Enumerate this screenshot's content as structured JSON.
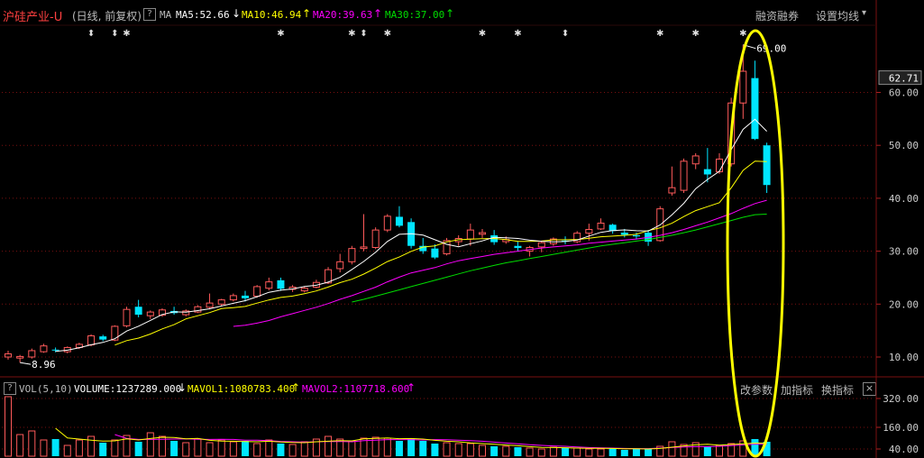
{
  "header": {
    "stock_name": "沪硅产业-U",
    "period": "(日线, 前复权)",
    "help_icon": "?",
    "ma_label": "MA",
    "ma5": "MA5:52.66",
    "ma10": "MA10:46.94",
    "ma20": "MA20:39.63",
    "ma30": "MA30:37.00",
    "menu_margin": "融资融券",
    "menu_settings": "设置均线",
    "menu_caret": "▾"
  },
  "volume_header": {
    "help_icon": "?",
    "label": "VOL(5,10)",
    "volume": "VOLUME:1237289.000",
    "mavol1": "MAVOL1:1080783.400",
    "mavol2": "MAVOL2:1107718.600",
    "btn_params": "改参数",
    "btn_add": "加指标",
    "btn_switch": "换指标",
    "btn_close": "×"
  },
  "colors": {
    "up": "#ff5a5a",
    "down": "#00e5ff",
    "ma5": "#ffffff",
    "ma10": "#ffff00",
    "ma20": "#ff00ff",
    "ma30": "#00dd00",
    "grid": "#7a1010",
    "highlight": "#ffff00"
  },
  "chart_data": [
    {
      "type": "candlestick",
      "y_ticks": [
        "10.00",
        "20.00",
        "30.00",
        "40.00",
        "50.00",
        "60.00"
      ],
      "ylim": [
        5,
        72
      ],
      "current_price": "62.71",
      "high_label": "69.00",
      "low_label": "8.96",
      "ohlc": [
        [
          10.0,
          11.2,
          9.5,
          10.6
        ],
        [
          9.8,
          10.4,
          8.96,
          10.1
        ],
        [
          10.0,
          11.6,
          9.7,
          11.2
        ],
        [
          11.0,
          12.5,
          10.8,
          12.1
        ],
        [
          11.4,
          11.8,
          10.9,
          11.3
        ],
        [
          11.0,
          12.0,
          10.7,
          11.8
        ],
        [
          11.8,
          12.7,
          11.5,
          12.4
        ],
        [
          12.3,
          14.3,
          12.0,
          14.0
        ],
        [
          13.9,
          14.2,
          13.0,
          13.3
        ],
        [
          13.2,
          16.0,
          13.0,
          15.8
        ],
        [
          15.9,
          19.5,
          15.6,
          19.0
        ],
        [
          19.5,
          20.8,
          17.5,
          18.0
        ],
        [
          17.8,
          18.8,
          17.2,
          18.5
        ],
        [
          17.9,
          19.2,
          17.6,
          18.9
        ],
        [
          18.7,
          19.5,
          18.0,
          18.3
        ],
        [
          18.0,
          19.0,
          17.7,
          18.7
        ],
        [
          18.5,
          19.8,
          18.3,
          19.5
        ],
        [
          19.4,
          22.0,
          19.0,
          20.2
        ],
        [
          20.0,
          21.0,
          19.6,
          20.8
        ],
        [
          20.8,
          22.0,
          20.5,
          21.6
        ],
        [
          21.6,
          22.5,
          20.5,
          21.1
        ],
        [
          21.5,
          23.6,
          21.2,
          23.3
        ],
        [
          23.0,
          25.0,
          22.6,
          24.2
        ],
        [
          24.5,
          25.0,
          22.5,
          22.9
        ],
        [
          22.8,
          23.6,
          22.3,
          23.2
        ],
        [
          22.5,
          23.4,
          22.2,
          23.0
        ],
        [
          23.2,
          24.6,
          23.0,
          24.1
        ],
        [
          24.0,
          27.0,
          23.8,
          26.5
        ],
        [
          26.7,
          29.5,
          26.0,
          28.0
        ],
        [
          28.0,
          31.0,
          27.5,
          30.5
        ],
        [
          30.5,
          37.0,
          30.0,
          30.8
        ],
        [
          30.7,
          34.5,
          30.4,
          34.0
        ],
        [
          34.0,
          37.0,
          33.6,
          36.6
        ],
        [
          36.5,
          38.5,
          34.5,
          34.8
        ],
        [
          35.5,
          36.2,
          30.5,
          31.0
        ],
        [
          31.0,
          32.5,
          29.5,
          30.0
        ],
        [
          30.5,
          31.3,
          28.5,
          28.8
        ],
        [
          29.5,
          32.5,
          29.2,
          32.0
        ],
        [
          31.8,
          33.0,
          31.0,
          32.4
        ],
        [
          32.3,
          35.2,
          31.0,
          34.0
        ],
        [
          33.2,
          34.2,
          32.5,
          33.5
        ],
        [
          33.0,
          34.0,
          31.2,
          31.7
        ],
        [
          31.8,
          32.8,
          31.4,
          32.2
        ],
        [
          31.0,
          31.8,
          30.0,
          30.6
        ],
        [
          30.0,
          31.0,
          29.0,
          30.7
        ],
        [
          30.8,
          32.0,
          29.8,
          31.6
        ],
        [
          31.4,
          32.6,
          31.0,
          32.3
        ],
        [
          32.0,
          32.8,
          31.3,
          31.9
        ],
        [
          31.8,
          33.8,
          31.5,
          33.4
        ],
        [
          33.4,
          35.2,
          32.0,
          34.1
        ],
        [
          34.2,
          36.2,
          34.0,
          35.3
        ],
        [
          35.0,
          35.2,
          33.3,
          33.8
        ],
        [
          33.5,
          34.2,
          32.6,
          33.1
        ],
        [
          33.0,
          33.5,
          32.2,
          32.8
        ],
        [
          33.5,
          34.0,
          31.0,
          31.8
        ],
        [
          32.0,
          38.5,
          31.8,
          38.0
        ],
        [
          41.0,
          46.0,
          40.5,
          42.0
        ],
        [
          41.5,
          47.5,
          41.0,
          47.0
        ],
        [
          46.5,
          48.5,
          45.5,
          48.0
        ],
        [
          45.5,
          49.5,
          43.0,
          44.5
        ],
        [
          45.0,
          48.5,
          44.6,
          47.4
        ],
        [
          46.5,
          59.0,
          46.0,
          58.0
        ],
        [
          58.0,
          69.0,
          55.0,
          64.0
        ],
        [
          62.71,
          66.0,
          51.0,
          51.2
        ],
        [
          50.0,
          50.5,
          41.0,
          42.5
        ]
      ],
      "ma5": [
        null,
        null,
        null,
        null,
        11.06,
        11.3,
        11.76,
        12.32,
        12.76,
        13.46,
        14.9,
        15.82,
        16.92,
        18.04,
        18.54,
        18.48,
        18.78,
        19.12,
        19.64,
        20.16,
        20.64,
        21.4,
        22.24,
        22.62,
        22.86,
        23.32,
        23.56,
        24.16,
        25.06,
        26.54,
        28.06,
        29.8,
        31.84,
        33.18,
        33.3,
        33.04,
        32.16,
        31.3,
        30.84,
        31.42,
        31.94,
        32.62,
        32.52,
        32.4,
        32.08,
        31.88,
        31.76,
        31.82,
        32.12,
        32.86,
        33.56,
        33.9,
        34.02,
        33.86,
        33.8,
        34.96,
        36.88,
        39.04,
        41.8,
        43.56,
        45.1,
        49.18,
        53.02,
        54.92,
        52.66
      ],
      "ma10": [
        null,
        null,
        null,
        null,
        null,
        null,
        null,
        null,
        null,
        12.26,
        13.1,
        13.58,
        14.34,
        15.32,
        16.12,
        17.2,
        17.8,
        18.4,
        19.14,
        19.34,
        19.56,
        20.18,
        20.78,
        21.26,
        21.52,
        21.98,
        22.48,
        23.22,
        24.06,
        24.7,
        25.68,
        26.82,
        28.04,
        28.9,
        29.96,
        30.78,
        31.0,
        31.76,
        32.16,
        32.28,
        32.36,
        32.4,
        32.18,
        31.84,
        31.84,
        31.9,
        32.14,
        32.16,
        32.2,
        32.46,
        32.72,
        32.84,
        33.0,
        33.18,
        33.88,
        34.42,
        35.28,
        36.54,
        37.66,
        38.42,
        39.16,
        41.96,
        45.26,
        47.02,
        46.94
      ],
      "ma20": [
        null,
        null,
        null,
        null,
        null,
        null,
        null,
        null,
        null,
        null,
        null,
        null,
        null,
        null,
        null,
        null,
        null,
        null,
        null,
        15.8,
        16.0,
        16.4,
        16.9,
        17.6,
        18.2,
        18.8,
        19.4,
        20.1,
        20.9,
        21.6,
        22.4,
        23.2,
        24.2,
        25.1,
        25.9,
        26.4,
        26.9,
        27.6,
        28.2,
        28.6,
        29.0,
        29.4,
        29.7,
        30.0,
        30.3,
        30.6,
        30.8,
        31.0,
        31.2,
        31.5,
        31.7,
        31.9,
        32.1,
        32.3,
        32.6,
        33.0,
        33.5,
        34.1,
        34.8,
        35.5,
        36.3,
        37.1,
        38.1,
        39.0,
        39.63
      ],
      "ma30": [
        null,
        null,
        null,
        null,
        null,
        null,
        null,
        null,
        null,
        null,
        null,
        null,
        null,
        null,
        null,
        null,
        null,
        null,
        null,
        null,
        null,
        null,
        null,
        null,
        null,
        null,
        null,
        null,
        null,
        20.4,
        20.9,
        21.5,
        22.1,
        22.7,
        23.3,
        23.9,
        24.5,
        25.1,
        25.7,
        26.3,
        26.8,
        27.3,
        27.8,
        28.2,
        28.6,
        29.0,
        29.4,
        29.8,
        30.2,
        30.6,
        31.0,
        31.3,
        31.6,
        31.9,
        32.2,
        32.6,
        33.0,
        33.5,
        34.0,
        34.6,
        35.2,
        35.8,
        36.4,
        36.9,
        37.0
      ]
    },
    {
      "type": "bar",
      "y_ticks": [
        "40.00",
        "160.00",
        "320.00"
      ],
      "ylim": [
        0,
        340
      ],
      "volume": [
        330,
        120,
        140,
        90,
        95,
        60,
        90,
        110,
        75,
        90,
        115,
        80,
        130,
        110,
        85,
        75,
        95,
        75,
        90,
        80,
        85,
        70,
        90,
        70,
        65,
        80,
        95,
        110,
        95,
        85,
        100,
        105,
        100,
        85,
        100,
        85,
        70,
        75,
        70,
        70,
        60,
        55,
        55,
        50,
        45,
        40,
        50,
        45,
        45,
        40,
        40,
        45,
        35,
        40,
        40,
        55,
        80,
        65,
        75,
        55,
        60,
        70,
        85,
        95,
        80
      ],
      "mavol1": [
        null,
        null,
        null,
        null,
        155,
        101,
        95,
        89,
        84,
        85,
        96,
        90,
        98,
        105,
        104,
        96,
        99,
        88,
        84,
        83,
        81,
        80,
        83,
        79,
        76,
        75,
        80,
        83,
        86,
        85,
        96,
        99,
        101,
        97,
        98,
        95,
        88,
        83,
        80,
        74,
        70,
        66,
        62,
        58,
        53,
        49,
        48,
        47,
        45,
        44,
        44,
        43,
        41,
        41,
        40,
        43,
        50,
        57,
        63,
        66,
        61,
        65,
        69,
        73,
        72
      ],
      "mavol2": [
        null,
        null,
        null,
        null,
        null,
        null,
        null,
        null,
        null,
        120,
        99,
        93,
        93,
        94,
        95,
        96,
        94,
        93,
        94,
        93,
        89,
        89,
        86,
        82,
        80,
        78,
        80,
        81,
        82,
        80,
        86,
        89,
        92,
        92,
        92,
        90,
        92,
        91,
        89,
        86,
        83,
        78,
        73,
        69,
        64,
        60,
        57,
        55,
        51,
        48,
        46,
        45,
        43,
        42,
        42,
        45,
        48,
        51,
        53,
        53,
        55,
        59,
        63,
        66,
        66
      ]
    }
  ],
  "event_markers": [
    "⬍",
    "⬍",
    "✱",
    "✱",
    "✱",
    "⬍",
    "✱",
    "✱",
    "✱",
    "⬍",
    "✱",
    "✱",
    "✱"
  ]
}
